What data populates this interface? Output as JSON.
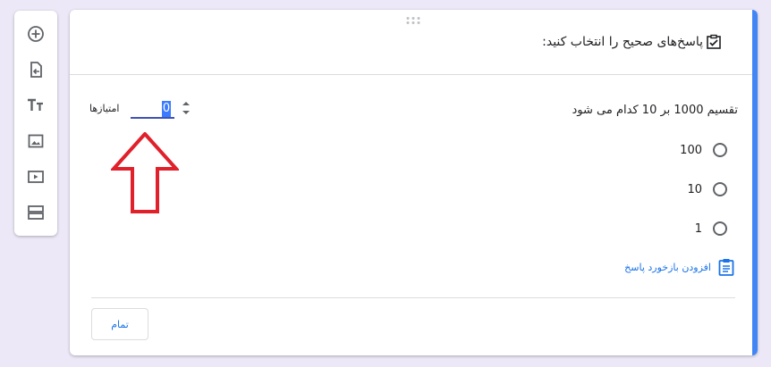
{
  "toolbar": {
    "items": [
      {
        "icon": "add-circle-icon"
      },
      {
        "icon": "import-question-icon"
      },
      {
        "icon": "title-text-icon"
      },
      {
        "icon": "image-icon"
      },
      {
        "icon": "video-icon"
      },
      {
        "icon": "section-icon"
      }
    ]
  },
  "card": {
    "header_title": "پاسخ‌های صحیح را انتخاب کنید:",
    "question": "تقسیم 1000 بر 10 کدام می شود",
    "points": {
      "label": "امتیازها",
      "value": "0"
    },
    "options": [
      {
        "label": "100"
      },
      {
        "label": "10"
      },
      {
        "label": "1"
      }
    ],
    "feedback_label": "افزودن بازخورد پاسخ",
    "done_label": "تمام"
  },
  "colors": {
    "accent": "#4285f4",
    "link": "#1a73e8",
    "annotation_arrow": "#e0202a"
  }
}
